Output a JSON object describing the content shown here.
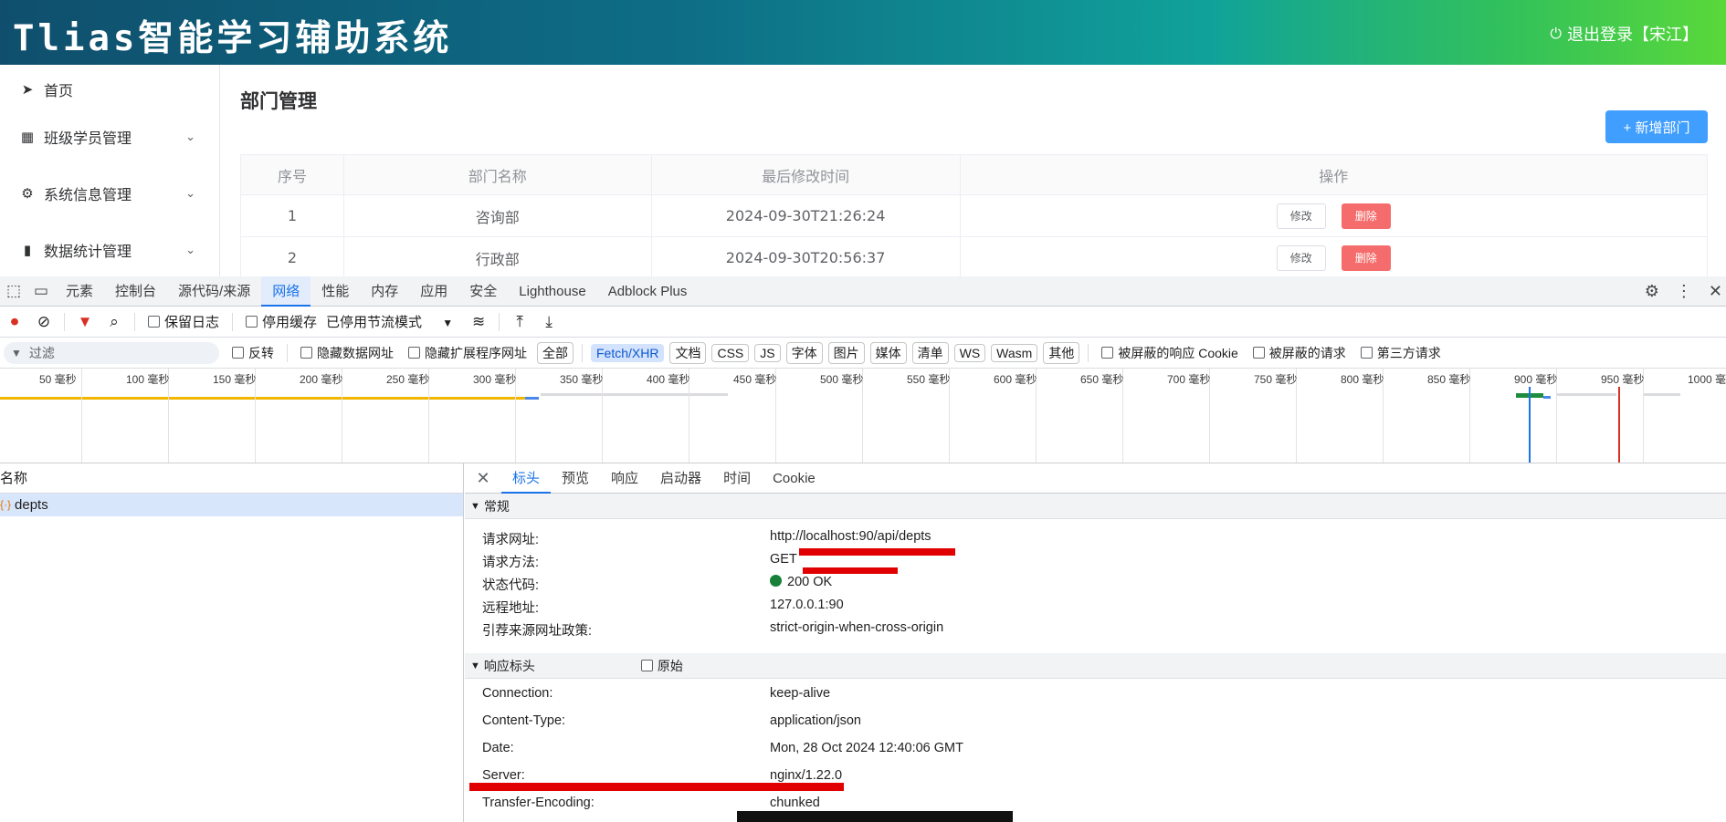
{
  "app": {
    "title": "Tlias智能学习辅助系统",
    "logout": "退出登录【宋江】"
  },
  "sidebar": {
    "items": [
      {
        "label": "首页",
        "icon": "send-icon"
      },
      {
        "label": "班级学员管理",
        "icon": "grid-icon"
      },
      {
        "label": "系统信息管理",
        "icon": "gear-icon"
      },
      {
        "label": "数据统计管理",
        "icon": "bar-chart-icon"
      }
    ]
  },
  "main": {
    "title": "部门管理",
    "add_button": "+ 新增部门",
    "table": {
      "headers": [
        "序号",
        "部门名称",
        "最后修改时间",
        "操作"
      ],
      "rows": [
        {
          "index": "1",
          "name": "咨询部",
          "time": "2024-09-30T21:26:24",
          "edit": "修改",
          "delete": "删除"
        },
        {
          "index": "2",
          "name": "行政部",
          "time": "2024-09-30T20:56:37",
          "edit": "修改",
          "delete": "删除"
        }
      ]
    }
  },
  "devtools": {
    "tabs": [
      "元素",
      "控制台",
      "源代码/来源",
      "网络",
      "性能",
      "内存",
      "应用",
      "安全",
      "Lighthouse",
      "Adblock Plus"
    ],
    "active_tab": "网络",
    "toolbar": {
      "preserve_log": "保留日志",
      "disable_cache": "停用缓存",
      "throttle": "已停用节流模式"
    },
    "filter": {
      "placeholder": "过滤",
      "invert": "反转",
      "hide_data_urls": "隐藏数据网址",
      "hide_ext_urls": "隐藏扩展程序网址",
      "types": [
        "全部",
        "Fetch/XHR",
        "文档",
        "CSS",
        "JS",
        "字体",
        "图片",
        "媒体",
        "清单",
        "WS",
        "Wasm",
        "其他"
      ],
      "active_type": "Fetch/XHR",
      "blocked_cookies": "被屏蔽的响应 Cookie",
      "blocked_requests": "被屏蔽的请求",
      "third_party": "第三方请求"
    },
    "timeline_labels": [
      "50 毫秒",
      "100 毫秒",
      "150 毫秒",
      "200 毫秒",
      "250 毫秒",
      "300 毫秒",
      "350 毫秒",
      "400 毫秒",
      "450 毫秒",
      "500 毫秒",
      "550 毫秒",
      "600 毫秒",
      "650 毫秒",
      "700 毫秒",
      "750 毫秒",
      "800 毫秒",
      "850 毫秒",
      "900 毫秒",
      "950 毫秒",
      "1000 毫秒"
    ],
    "name_header": "名称",
    "request_name": "depts",
    "detail_tabs": [
      "标头",
      "预览",
      "响应",
      "启动器",
      "时间",
      "Cookie"
    ],
    "general": {
      "title": "常规",
      "rows": [
        {
          "k": "请求网址:",
          "v": "http://localhost:90/api/depts"
        },
        {
          "k": "请求方法:",
          "v": "GET"
        },
        {
          "k": "状态代码:",
          "v": "200 OK"
        },
        {
          "k": "远程地址:",
          "v": "127.0.0.1:90"
        },
        {
          "k": "引荐来源网址政策:",
          "v": "strict-origin-when-cross-origin"
        }
      ]
    },
    "response_headers": {
      "title": "响应标头",
      "raw": "原始",
      "rows": [
        {
          "k": "Connection:",
          "v": "keep-alive"
        },
        {
          "k": "Content-Type:",
          "v": "application/json"
        },
        {
          "k": "Date:",
          "v": "Mon, 28 Oct 2024 12:40:06 GMT"
        },
        {
          "k": "Server:",
          "v": "nginx/1.22.0"
        },
        {
          "k": "Transfer-Encoding:",
          "v": "chunked"
        }
      ]
    }
  }
}
